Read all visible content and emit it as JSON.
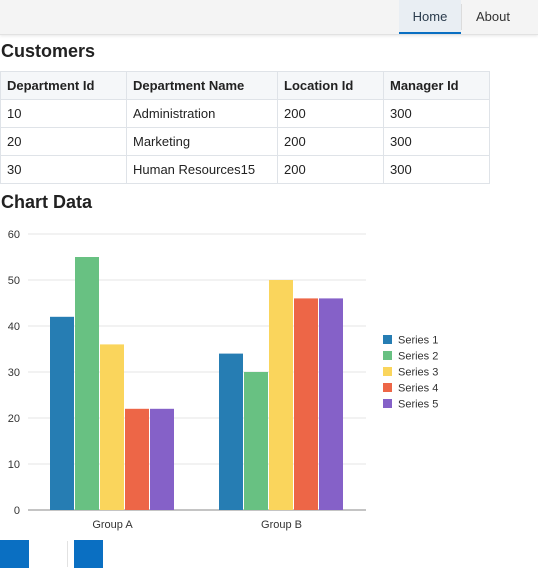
{
  "nav": {
    "tabs": [
      {
        "label": "Home",
        "active": true
      },
      {
        "label": "About",
        "active": false
      }
    ]
  },
  "customers": {
    "title": "Customers",
    "columns": [
      "Department Id",
      "Department Name",
      "Location Id",
      "Manager Id"
    ],
    "rows": [
      [
        "10",
        "Administration",
        "200",
        "300"
      ],
      [
        "20",
        "Marketing",
        "200",
        "300"
      ],
      [
        "30",
        "Human Resources15",
        "200",
        "300"
      ]
    ]
  },
  "chart_section": {
    "title": "Chart Data"
  },
  "chart_data": {
    "type": "bar",
    "categories": [
      "Group A",
      "Group B"
    ],
    "series": [
      {
        "name": "Series 1",
        "values": [
          42,
          34
        ],
        "color": "#267db3"
      },
      {
        "name": "Series 2",
        "values": [
          55,
          30
        ],
        "color": "#68c182"
      },
      {
        "name": "Series 3",
        "values": [
          36,
          50
        ],
        "color": "#fad55c"
      },
      {
        "name": "Series 4",
        "values": [
          22,
          46
        ],
        "color": "#ed6647"
      },
      {
        "name": "Series 5",
        "values": [
          22,
          46
        ],
        "color": "#8561c8"
      }
    ],
    "ylim": [
      0,
      60
    ],
    "yticks": [
      "0",
      "10",
      "20",
      "30",
      "40",
      "50",
      "60"
    ],
    "grid": true,
    "legend_position": "right"
  },
  "colors": {
    "accent": "#0a6fc2"
  }
}
